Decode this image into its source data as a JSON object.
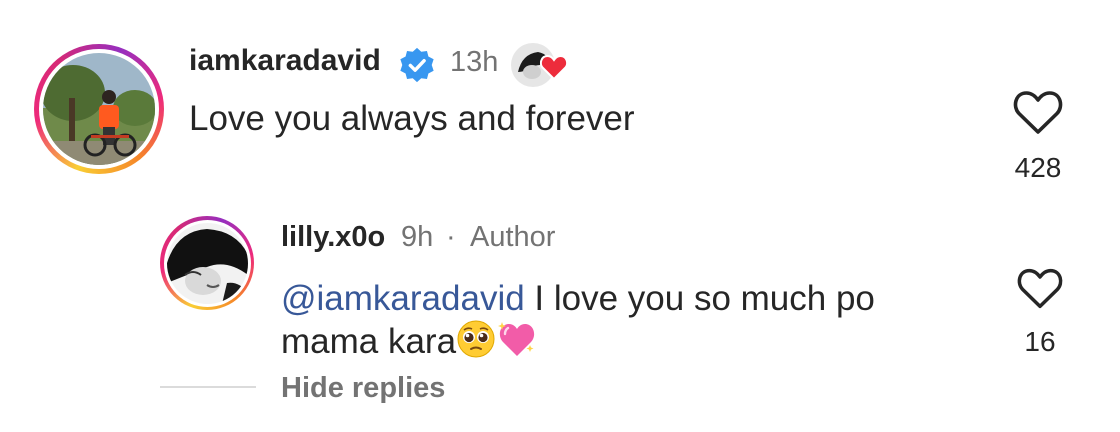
{
  "comment": {
    "username": "iamkaradavid",
    "time": "13h",
    "text": "Love you always and forever",
    "likes": "428",
    "verified": true
  },
  "reply": {
    "username": "lilly.x0o",
    "time": "9h",
    "separator": "·",
    "author_badge": "Author",
    "mention": "@iamkaradavid",
    "text_after_mention": " I love you so much po mama kara",
    "emojis": [
      "pleading-face",
      "sparkling-heart"
    ],
    "likes": "16"
  },
  "thread": {
    "hide_replies_label": "Hide replies"
  },
  "colors": {
    "verified_blue": "#3897f0",
    "mention_blue": "#385898",
    "meta_gray": "#737373",
    "text": "#262626"
  }
}
